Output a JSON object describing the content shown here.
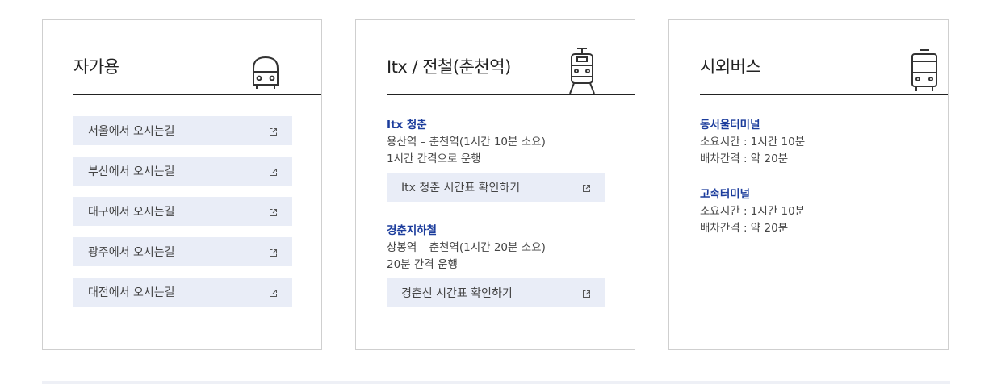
{
  "cards": {
    "car": {
      "title": "자가용",
      "icon": "car-icon",
      "links": [
        {
          "label": "서울에서 오시는길"
        },
        {
          "label": "부산에서 오시는길"
        },
        {
          "label": "대구에서 오시는길"
        },
        {
          "label": "광주에서 오시는길"
        },
        {
          "label": "대전에서 오시는길"
        }
      ]
    },
    "train": {
      "title": "Itx / 전철(춘천역)",
      "icon": "train-icon",
      "sections": [
        {
          "title": "Itx 청춘",
          "line1": "용산역 – 춘천역(1시간 10분 소요)",
          "line2": "1시간 간격으로 운행",
          "button": "Itx 청춘 시간표 확인하기"
        },
        {
          "title": "경춘지하철",
          "line1": "상봉역 – 춘천역(1시간 20분 소요)",
          "line2": "20분 간격 운행",
          "button": "경춘선 시간표 확인하기"
        }
      ]
    },
    "bus": {
      "title": "시외버스",
      "icon": "bus-icon",
      "sections": [
        {
          "title": "동서울터미널",
          "line1": "소요시간 : 1시간 10분",
          "line2": "배차간격 : 약 20분"
        },
        {
          "title": "고속터미널",
          "line1": "소요시간 : 1시간 10분",
          "line2": "배차간격 : 약 20분"
        }
      ]
    }
  },
  "colors": {
    "accent": "#1b3c9c",
    "button_bg": "#e9edf7",
    "border": "#cfcfcf"
  }
}
